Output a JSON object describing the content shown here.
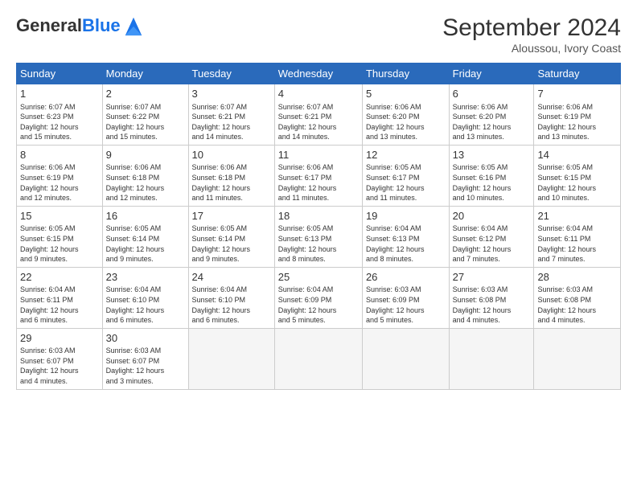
{
  "header": {
    "logo_general": "General",
    "logo_blue": "Blue",
    "month_title": "September 2024",
    "location": "Aloussou, Ivory Coast"
  },
  "weekdays": [
    "Sunday",
    "Monday",
    "Tuesday",
    "Wednesday",
    "Thursday",
    "Friday",
    "Saturday"
  ],
  "weeks": [
    [
      {
        "day": "1",
        "info": "Sunrise: 6:07 AM\nSunset: 6:23 PM\nDaylight: 12 hours\nand 15 minutes."
      },
      {
        "day": "2",
        "info": "Sunrise: 6:07 AM\nSunset: 6:22 PM\nDaylight: 12 hours\nand 15 minutes."
      },
      {
        "day": "3",
        "info": "Sunrise: 6:07 AM\nSunset: 6:21 PM\nDaylight: 12 hours\nand 14 minutes."
      },
      {
        "day": "4",
        "info": "Sunrise: 6:07 AM\nSunset: 6:21 PM\nDaylight: 12 hours\nand 14 minutes."
      },
      {
        "day": "5",
        "info": "Sunrise: 6:06 AM\nSunset: 6:20 PM\nDaylight: 12 hours\nand 13 minutes."
      },
      {
        "day": "6",
        "info": "Sunrise: 6:06 AM\nSunset: 6:20 PM\nDaylight: 12 hours\nand 13 minutes."
      },
      {
        "day": "7",
        "info": "Sunrise: 6:06 AM\nSunset: 6:19 PM\nDaylight: 12 hours\nand 13 minutes."
      }
    ],
    [
      {
        "day": "8",
        "info": "Sunrise: 6:06 AM\nSunset: 6:19 PM\nDaylight: 12 hours\nand 12 minutes."
      },
      {
        "day": "9",
        "info": "Sunrise: 6:06 AM\nSunset: 6:18 PM\nDaylight: 12 hours\nand 12 minutes."
      },
      {
        "day": "10",
        "info": "Sunrise: 6:06 AM\nSunset: 6:18 PM\nDaylight: 12 hours\nand 11 minutes."
      },
      {
        "day": "11",
        "info": "Sunrise: 6:06 AM\nSunset: 6:17 PM\nDaylight: 12 hours\nand 11 minutes."
      },
      {
        "day": "12",
        "info": "Sunrise: 6:05 AM\nSunset: 6:17 PM\nDaylight: 12 hours\nand 11 minutes."
      },
      {
        "day": "13",
        "info": "Sunrise: 6:05 AM\nSunset: 6:16 PM\nDaylight: 12 hours\nand 10 minutes."
      },
      {
        "day": "14",
        "info": "Sunrise: 6:05 AM\nSunset: 6:15 PM\nDaylight: 12 hours\nand 10 minutes."
      }
    ],
    [
      {
        "day": "15",
        "info": "Sunrise: 6:05 AM\nSunset: 6:15 PM\nDaylight: 12 hours\nand 9 minutes."
      },
      {
        "day": "16",
        "info": "Sunrise: 6:05 AM\nSunset: 6:14 PM\nDaylight: 12 hours\nand 9 minutes."
      },
      {
        "day": "17",
        "info": "Sunrise: 6:05 AM\nSunset: 6:14 PM\nDaylight: 12 hours\nand 9 minutes."
      },
      {
        "day": "18",
        "info": "Sunrise: 6:05 AM\nSunset: 6:13 PM\nDaylight: 12 hours\nand 8 minutes."
      },
      {
        "day": "19",
        "info": "Sunrise: 6:04 AM\nSunset: 6:13 PM\nDaylight: 12 hours\nand 8 minutes."
      },
      {
        "day": "20",
        "info": "Sunrise: 6:04 AM\nSunset: 6:12 PM\nDaylight: 12 hours\nand 7 minutes."
      },
      {
        "day": "21",
        "info": "Sunrise: 6:04 AM\nSunset: 6:11 PM\nDaylight: 12 hours\nand 7 minutes."
      }
    ],
    [
      {
        "day": "22",
        "info": "Sunrise: 6:04 AM\nSunset: 6:11 PM\nDaylight: 12 hours\nand 6 minutes."
      },
      {
        "day": "23",
        "info": "Sunrise: 6:04 AM\nSunset: 6:10 PM\nDaylight: 12 hours\nand 6 minutes."
      },
      {
        "day": "24",
        "info": "Sunrise: 6:04 AM\nSunset: 6:10 PM\nDaylight: 12 hours\nand 6 minutes."
      },
      {
        "day": "25",
        "info": "Sunrise: 6:04 AM\nSunset: 6:09 PM\nDaylight: 12 hours\nand 5 minutes."
      },
      {
        "day": "26",
        "info": "Sunrise: 6:03 AM\nSunset: 6:09 PM\nDaylight: 12 hours\nand 5 minutes."
      },
      {
        "day": "27",
        "info": "Sunrise: 6:03 AM\nSunset: 6:08 PM\nDaylight: 12 hours\nand 4 minutes."
      },
      {
        "day": "28",
        "info": "Sunrise: 6:03 AM\nSunset: 6:08 PM\nDaylight: 12 hours\nand 4 minutes."
      }
    ],
    [
      {
        "day": "29",
        "info": "Sunrise: 6:03 AM\nSunset: 6:07 PM\nDaylight: 12 hours\nand 4 minutes."
      },
      {
        "day": "30",
        "info": "Sunrise: 6:03 AM\nSunset: 6:07 PM\nDaylight: 12 hours\nand 3 minutes."
      },
      {
        "day": "",
        "info": ""
      },
      {
        "day": "",
        "info": ""
      },
      {
        "day": "",
        "info": ""
      },
      {
        "day": "",
        "info": ""
      },
      {
        "day": "",
        "info": ""
      }
    ]
  ]
}
